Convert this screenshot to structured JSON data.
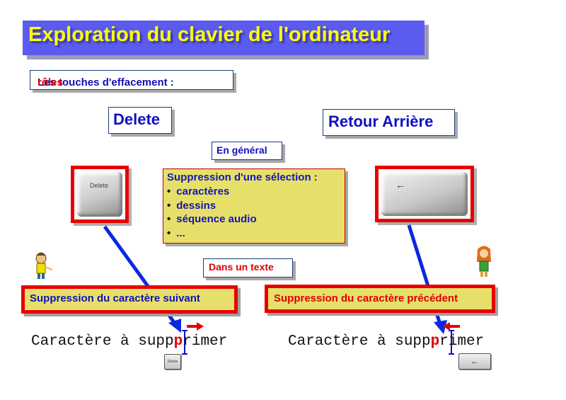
{
  "title": "Exploration du clavier de l'ordinateur",
  "subtitle": {
    "prefix": "Les touches d'effacement : ",
    "highlight": "rôles"
  },
  "keys": {
    "delete": {
      "label": "Delete",
      "cap_text": "Delete"
    },
    "backspace": {
      "label": "Retour Arrière",
      "cap_symbol": "←"
    }
  },
  "general": {
    "label": "En général",
    "heading": "Suppression d'une sélection :",
    "items": [
      "caractères",
      "dessins",
      "séquence audio",
      "..."
    ]
  },
  "in_text": {
    "label": "Dans un texte"
  },
  "actions": {
    "delete_action": "Suppression du caractère suivant",
    "backspace_action": "Suppression du caractère précédent"
  },
  "examples": {
    "left": {
      "before": "Caractère à supp",
      "char": "p",
      "after": "rimer"
    },
    "right": {
      "before": "Caractère à supp",
      "char": "p",
      "after": "rimer"
    }
  },
  "mini_keys": {
    "left": "Delete",
    "right": "←"
  },
  "colors": {
    "title_bg": "#5b5bef",
    "title_text": "#ffff00",
    "accent_red": "#e80000",
    "text_blue": "#1010c0",
    "note_yellow": "#e6e06a"
  }
}
